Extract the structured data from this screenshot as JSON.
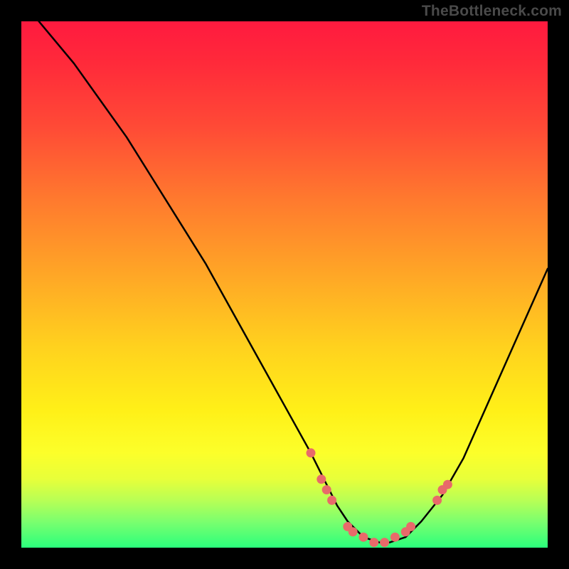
{
  "watermark": "TheBottleneck.com",
  "chart_data": {
    "type": "line",
    "title": "",
    "xlabel": "",
    "ylabel": "",
    "xlim": [
      0,
      100
    ],
    "ylim": [
      0,
      100
    ],
    "grid": false,
    "legend": false,
    "series": [
      {
        "name": "bottleneck-curve",
        "x": [
          0,
          5,
          10,
          15,
          20,
          25,
          30,
          35,
          40,
          45,
          50,
          55,
          58,
          60,
          62,
          65,
          68,
          70,
          73,
          76,
          80,
          84,
          88,
          92,
          96,
          100
        ],
        "y": [
          104,
          98,
          92,
          85,
          78,
          70,
          62,
          54,
          45,
          36,
          27,
          18,
          12,
          8,
          5,
          2,
          1,
          1,
          2,
          5,
          10,
          17,
          26,
          35,
          44,
          53
        ]
      }
    ],
    "markers": [
      {
        "x": 55,
        "y": 18
      },
      {
        "x": 57,
        "y": 13
      },
      {
        "x": 58,
        "y": 11
      },
      {
        "x": 59,
        "y": 9
      },
      {
        "x": 62,
        "y": 4
      },
      {
        "x": 63,
        "y": 3
      },
      {
        "x": 65,
        "y": 2
      },
      {
        "x": 67,
        "y": 1
      },
      {
        "x": 69,
        "y": 1
      },
      {
        "x": 71,
        "y": 2
      },
      {
        "x": 73,
        "y": 3
      },
      {
        "x": 74,
        "y": 4
      },
      {
        "x": 79,
        "y": 9
      },
      {
        "x": 80,
        "y": 11
      },
      {
        "x": 81,
        "y": 12
      }
    ],
    "colors": {
      "curve": "#000000",
      "marker": "#e86a6a",
      "gradient_top": "#ff1a3f",
      "gradient_bottom": "#2bff7c",
      "frame": "#000000"
    }
  }
}
